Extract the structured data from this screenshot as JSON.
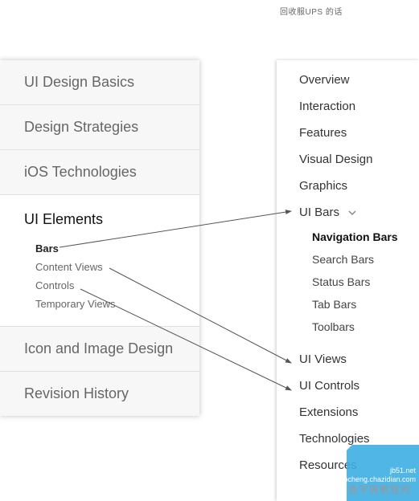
{
  "header": {
    "small_text": "回收服UPS 的话"
  },
  "left": {
    "sections": [
      {
        "title": "UI Design Basics"
      },
      {
        "title": "Design Strategies"
      },
      {
        "title": "iOS Technologies"
      },
      {
        "title": "UI Elements",
        "active": true,
        "items": [
          {
            "label": "Bars",
            "active": true
          },
          {
            "label": "Content Views"
          },
          {
            "label": "Controls"
          },
          {
            "label": "Temporary Views"
          }
        ]
      },
      {
        "title": "Icon and Image Design"
      },
      {
        "title": "Revision History"
      }
    ]
  },
  "right": {
    "items": [
      {
        "label": "Overview"
      },
      {
        "label": "Interaction"
      },
      {
        "label": "Features"
      },
      {
        "label": "Visual Design"
      },
      {
        "label": "Graphics"
      },
      {
        "label": "UI Bars",
        "expanded": true,
        "items": [
          {
            "label": "Navigation Bars",
            "active": true
          },
          {
            "label": "Search Bars"
          },
          {
            "label": "Status Bars"
          },
          {
            "label": "Tab Bars"
          },
          {
            "label": "Toolbars"
          }
        ]
      },
      {
        "label": "UI Views"
      },
      {
        "label": "UI Controls"
      },
      {
        "label": "Extensions"
      },
      {
        "label": "Technologies"
      },
      {
        "label": "Resources"
      }
    ]
  },
  "corner": {
    "line1": "jb51.net",
    "line2": "jiaocheng.chazidian.com"
  },
  "watermark": "查字典教程网"
}
